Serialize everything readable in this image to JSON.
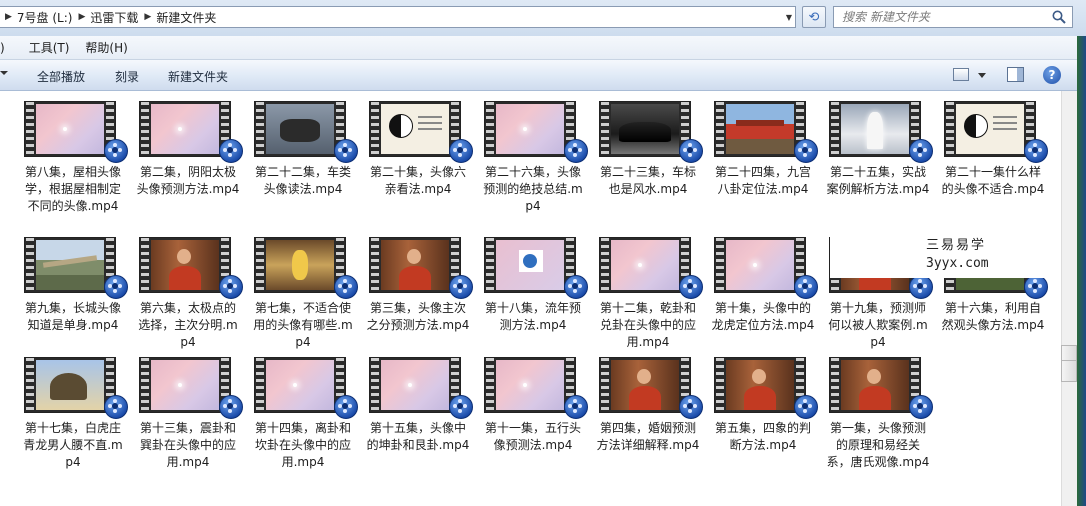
{
  "address": {
    "crumbs": [
      "7号盘 (L:)",
      "迅雷下载",
      "新建文件夹"
    ],
    "search_placeholder": "搜索 新建文件夹"
  },
  "menu": {
    "cut_item": ")",
    "items": [
      "工具(T)",
      "帮助(H)"
    ]
  },
  "toolbar": {
    "play_all": "全部播放",
    "burn": "刻录",
    "new_folder": "新建文件夹"
  },
  "files": [
    {
      "name": "第八集，屋相头像学，根据屋相制定不同的头像.mp4",
      "thumb": "pink"
    },
    {
      "name": "第二集，阴阳太极头像预测方法.mp4",
      "thumb": "pink"
    },
    {
      "name": "第二十二集，车类头像读法.mp4",
      "thumb": "moto"
    },
    {
      "name": "第二十集，头像六亲看法.mp4",
      "thumb": "taiji"
    },
    {
      "name": "第二十六集，头像预测的绝技总结.mp4",
      "thumb": "pink"
    },
    {
      "name": "第二十三集，车标也是风水.mp4",
      "thumb": "car"
    },
    {
      "name": "第二十四集，九宫八卦定位法.mp4",
      "thumb": "palace"
    },
    {
      "name": "第二十五集，实战案例解析方法.mp4",
      "thumb": "statue"
    },
    {
      "name": "第二十一集什么样的头像不适合.mp4",
      "thumb": "taiji"
    },
    {
      "name": "第九集，长城头像知道是单身.mp4",
      "thumb": "wall"
    },
    {
      "name": "第六集，太极点的选择，主次分明.mp4",
      "thumb": "man"
    },
    {
      "name": "第七集，不适合使用的头像有哪些.mp4",
      "thumb": "gold"
    },
    {
      "name": "第三集，头像主次之分预测方法.mp4",
      "thumb": "man"
    },
    {
      "name": "第十八集，流年预测方法.mp4",
      "thumb": "dot"
    },
    {
      "name": "第十二集，乾卦和兑卦在头像中的应用.mp4",
      "thumb": "pink"
    },
    {
      "name": "第十集，头像中的龙虎定位方法.mp4",
      "thumb": "pink"
    },
    {
      "name": "第十九集，预测师何以被人欺案例.mp4",
      "thumb": "man"
    },
    {
      "name": "第十六集，利用自然观头像方法.mp4",
      "thumb": "landscape"
    },
    {
      "name": "第十七集，白虎庄青龙男人腰不直.mp4",
      "thumb": "tree"
    },
    {
      "name": "第十三集，震卦和巽卦在头像中的应用.mp4",
      "thumb": "pink"
    },
    {
      "name": "第十四集，离卦和坎卦在头像中的应用.mp4",
      "thumb": "pink"
    },
    {
      "name": "第十五集，头像中的坤卦和艮卦.mp4",
      "thumb": "pink"
    },
    {
      "name": "第十一集，五行头像预测法.mp4",
      "thumb": "pink"
    },
    {
      "name": "第四集，婚姻预测方法详细解释.mp4",
      "thumb": "man"
    },
    {
      "name": "第五集，四象的判断方法.mp4",
      "thumb": "man"
    },
    {
      "name": "第一集，头像预测的原理和易经关系，唐氏观像.mp4",
      "thumb": "man"
    }
  ],
  "watermark": {
    "line1": "三易易学",
    "line2": "3yyx.com"
  },
  "colors": {
    "toolbar_top": "#f5f8fd",
    "toolbar_bottom": "#cfdcee",
    "badge_blue": "#1747a6"
  }
}
